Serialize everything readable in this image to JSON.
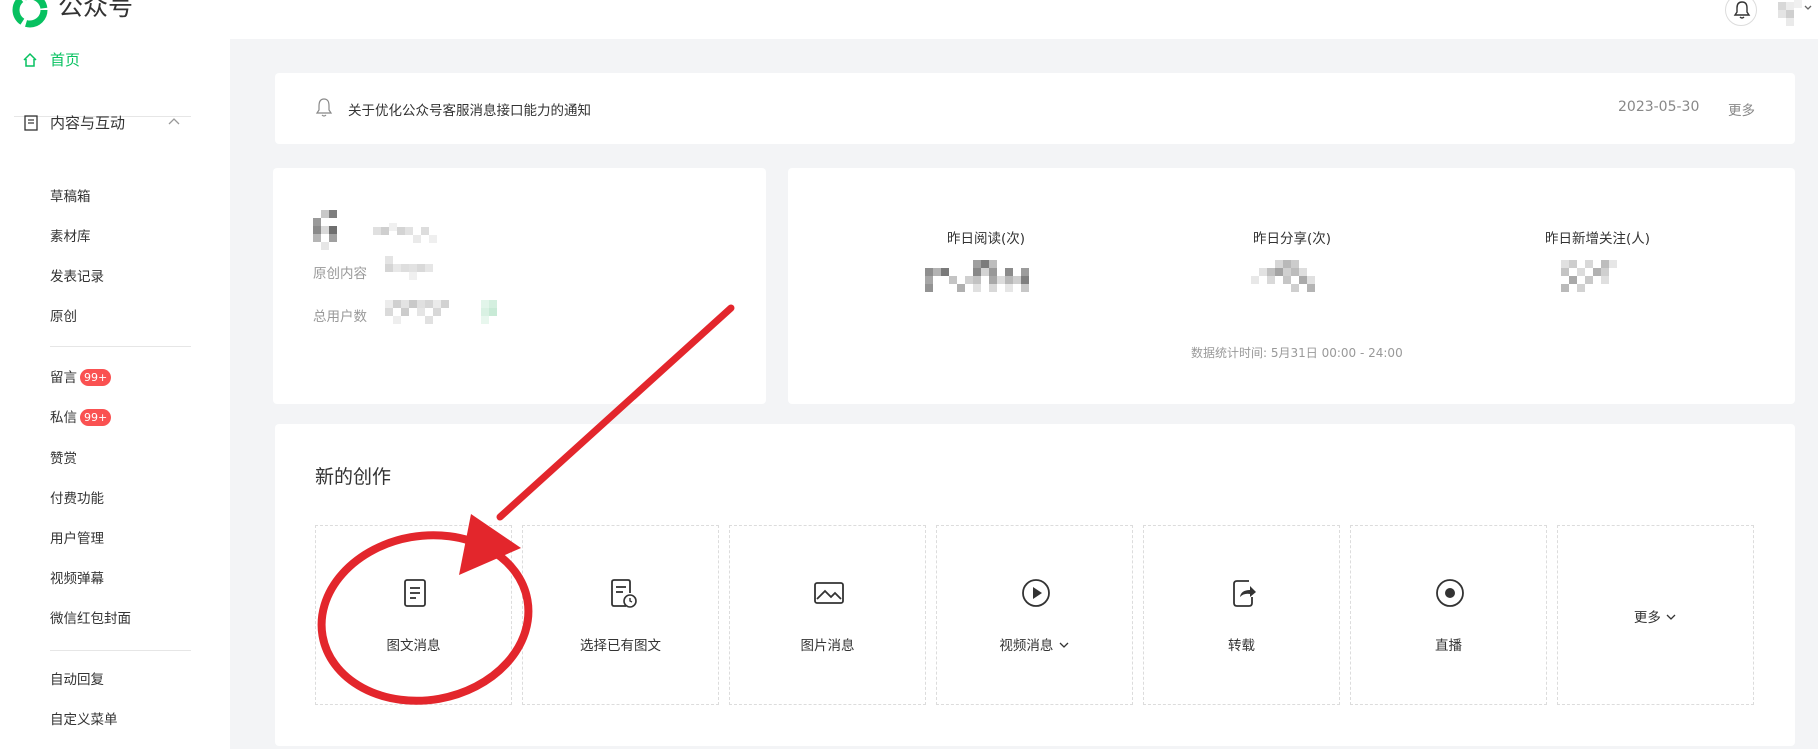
{
  "header": {
    "brand": "公众号"
  },
  "sidebar": {
    "home": "首页",
    "group": "内容与互动",
    "sub_items": [
      "草稿箱",
      "素材库",
      "发表记录",
      "原创"
    ],
    "interaction_items": [
      {
        "label": "留言",
        "badge": "99+"
      },
      {
        "label": "私信",
        "badge": "99+"
      },
      {
        "label": "赞赏"
      },
      {
        "label": "付费功能"
      },
      {
        "label": "用户管理"
      },
      {
        "label": "视频弹幕"
      },
      {
        "label": "微信红包封面"
      }
    ],
    "bottom_items": [
      "自动回复",
      "自定义菜单"
    ]
  },
  "notice": {
    "title": "关于优化公众号客服消息接口能力的通知",
    "date": "2023-05-30",
    "more": "更多"
  },
  "profile": {
    "original_label": "原创内容",
    "users_label": "总用户数"
  },
  "stats": {
    "reads_label": "昨日阅读(次)",
    "shares_label": "昨日分享(次)",
    "follows_label": "昨日新增关注(人)",
    "note": "数据统计时间: 5月31日 00:00 - 24:00"
  },
  "create": {
    "heading": "新的创作",
    "tiles": [
      {
        "label": "图文消息",
        "icon": "article-icon"
      },
      {
        "label": "选择已有图文",
        "icon": "article-clock-icon"
      },
      {
        "label": "图片消息",
        "icon": "image-icon"
      },
      {
        "label": "视频消息",
        "icon": "play-icon"
      },
      {
        "label": "转载",
        "icon": "repost-icon"
      },
      {
        "label": "直播",
        "icon": "live-icon"
      },
      {
        "label": "更多"
      }
    ]
  },
  "colors": {
    "accent": "#07c160",
    "badge": "#fa5151",
    "annotation": "#e3262c"
  }
}
